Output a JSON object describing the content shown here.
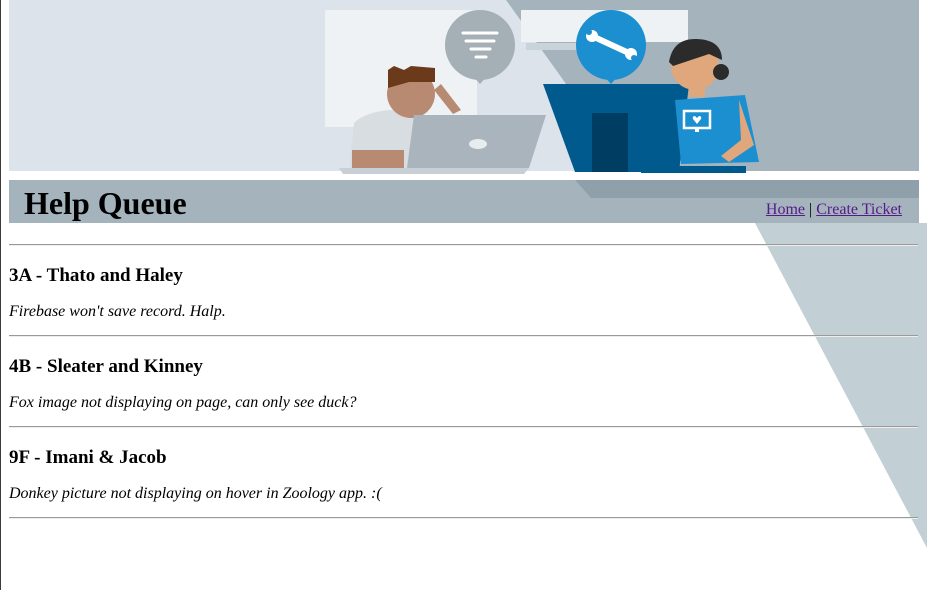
{
  "header": {
    "title": "Help Queue",
    "nav": {
      "home": "Home",
      "separator": "|",
      "create_ticket": "Create Ticket"
    }
  },
  "tickets": [
    {
      "heading": "3A - Thato and Haley",
      "issue": "Firebase won't save record. Halp."
    },
    {
      "heading": "4B - Sleater and Kinney",
      "issue": "Fox image not displaying on page, can only see duck?"
    },
    {
      "heading": "9F - Imani & Jacob",
      "issue": "Donkey picture not displaying on hover in Zoology app. :("
    }
  ],
  "colors": {
    "banner_light": "#dde3ea",
    "banner_mid": "#a5b3bd",
    "diagonal": "#c2d0d6",
    "accent_blue": "#1b8fd0",
    "monitor_blue": "#005a8e",
    "link_visited": "#551a8b"
  },
  "icons": {
    "left_bubble": "tornado-icon",
    "right_bubble": "wrench-icon",
    "shirt_badge": "monitor-heart-icon"
  }
}
